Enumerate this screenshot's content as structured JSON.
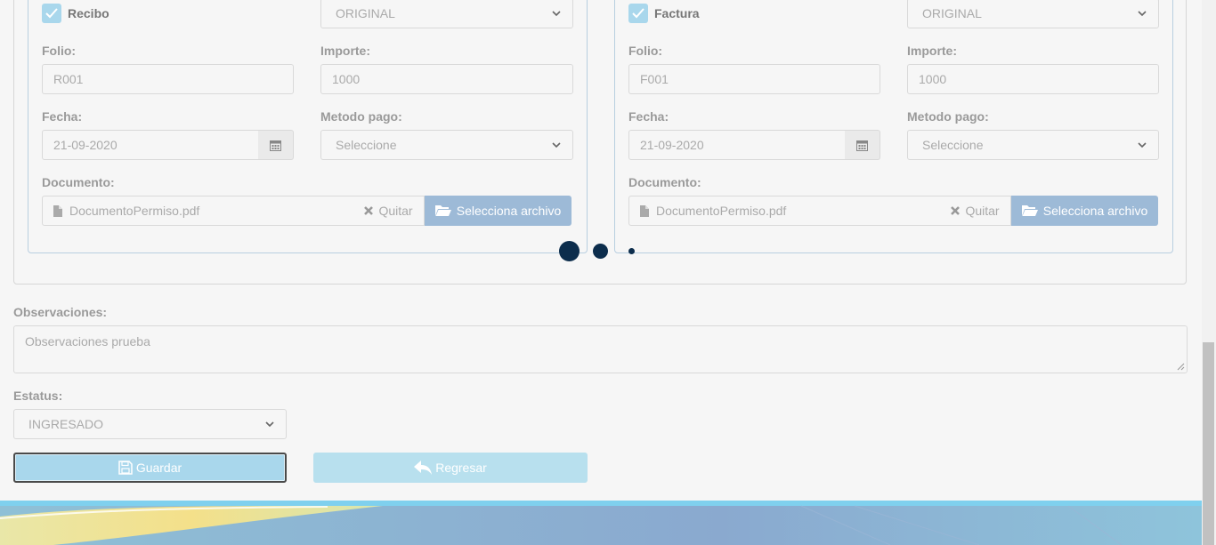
{
  "left_card": {
    "doc_type_label": "Recibo",
    "copy_select": "ORIGINAL",
    "folio_label": "Folio:",
    "folio_value": "R001",
    "importe_label": "Importe:",
    "importe_value": "1000",
    "fecha_label": "Fecha:",
    "fecha_value": "21-09-2020",
    "metodo_label": "Metodo pago:",
    "metodo_value": "Seleccione",
    "documento_label": "Documento:",
    "file_name": "DocumentoPermiso.pdf",
    "remove_label": "Quitar",
    "select_file_label": "Selecciona archivo"
  },
  "right_card": {
    "doc_type_label": "Factura",
    "copy_select": "ORIGINAL",
    "folio_label": "Folio:",
    "folio_value": "F001",
    "importe_label": "Importe:",
    "importe_value": "1000",
    "fecha_label": "Fecha:",
    "fecha_value": "21-09-2020",
    "metodo_label": "Metodo pago:",
    "metodo_value": "Seleccione",
    "documento_label": "Documento:",
    "file_name": "DocumentoPermiso.pdf",
    "remove_label": "Quitar",
    "select_file_label": "Selecciona archivo"
  },
  "observaciones": {
    "label": "Observaciones:",
    "value": "Observaciones prueba"
  },
  "estatus": {
    "label": "Estatus:",
    "value": "INGRESADO"
  },
  "actions": {
    "save_label": "Guardar",
    "back_label": "Regresar"
  },
  "colors": {
    "accent": "#a9d7ec",
    "file_button": "#9dbad7",
    "carousel_dot": "#0c2d4c"
  }
}
